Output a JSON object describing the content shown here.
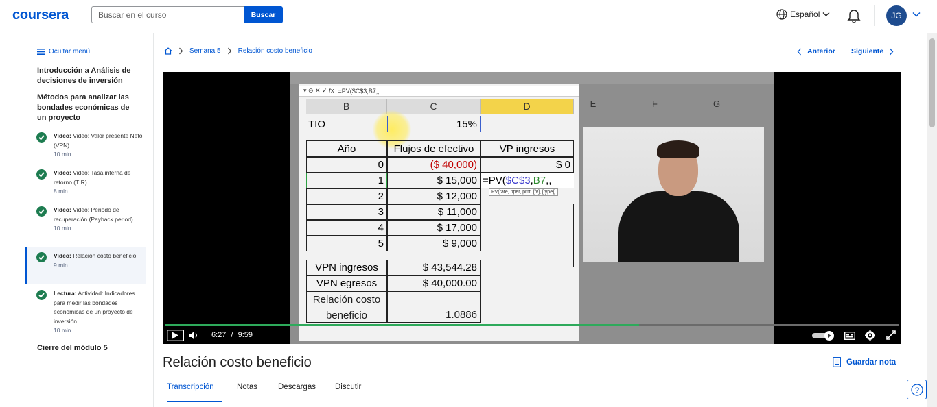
{
  "header": {
    "logo": "coursera",
    "search_placeholder": "Buscar en el curso",
    "search_button": "Buscar",
    "language": "Español",
    "avatar_initials": "JG"
  },
  "sidebar": {
    "hide_menu": "Ocultar menú",
    "module_title": "Introducción a Análisis de decisiones de inversión",
    "section_title": "Métodos para analizar las bondades económicas de un proyecto",
    "items": [
      {
        "type": "Video:",
        "label": "Video: Valor presente Neto (VPN)",
        "duration": "10 min"
      },
      {
        "type": "Video:",
        "label": "Video: Tasa interna de retorno (TIR)",
        "duration": "8 min"
      },
      {
        "type": "Video:",
        "label": "Video: Periodo de recuperación (Payback period)",
        "duration": "10 min"
      },
      {
        "type": "Video:",
        "label": "Relación costo beneficio",
        "duration": "9 min"
      },
      {
        "type": "Lectura:",
        "label": "Actividad: Indicadores para medir las bondades económicas de un proyecto de inversión",
        "duration": "10 min"
      }
    ],
    "next_module": "Cierre del módulo 5"
  },
  "breadcrumb": {
    "week": "Semana 5",
    "current": "Relación costo beneficio"
  },
  "nav": {
    "prev": "Anterior",
    "next": "Siguiente"
  },
  "video": {
    "formula_bar": "=PV($C$3,B7,,",
    "columns": [
      "B",
      "C",
      "D",
      "E",
      "F",
      "G"
    ],
    "tio_label": "TIO",
    "tio_value": "15%",
    "headers": [
      "Año",
      "Flujos de efectivo",
      "VP ingresos"
    ],
    "rows": [
      {
        "year": "0",
        "flow": "($ 40,000)",
        "vp": "$ 0"
      },
      {
        "year": "1",
        "flow": "$ 15,000",
        "vp": ""
      },
      {
        "year": "2",
        "flow": "$ 12,000",
        "vp": ""
      },
      {
        "year": "3",
        "flow": "$ 11,000",
        "vp": ""
      },
      {
        "year": "4",
        "flow": "$ 17,000",
        "vp": ""
      },
      {
        "year": "5",
        "flow": "$ 9,000",
        "vp": ""
      }
    ],
    "editing_formula": {
      "prefix": "=PV(",
      "ref1": "$C$3",
      "sep": ",",
      "ref2": "B7",
      "suffix": ",,"
    },
    "tooltip": "PV(rate, nper, pmt, [fv], [type])",
    "vpn_ingresos_label": "VPN ingresos",
    "vpn_ingresos_value": "$ 43,544.28",
    "vpn_egresos_label": "VPN egresos",
    "vpn_egresos_value": "$ 40,000.00",
    "ratio_label_1": "Relación costo",
    "ratio_label_2": "beneficio",
    "ratio_value": "1.0886",
    "current_time": "6:27",
    "separator": "/",
    "duration": "9:59",
    "progress_fraction": 0.646
  },
  "lesson": {
    "title": "Relación costo beneficio",
    "save_note": "Guardar nota",
    "tabs": [
      "Transcripción",
      "Notas",
      "Descargas",
      "Discutir"
    ]
  },
  "colors": {
    "accent": "#0056d2",
    "complete": "#1d7c50",
    "negative": "#c00000",
    "progress": "#2eaa5b"
  }
}
